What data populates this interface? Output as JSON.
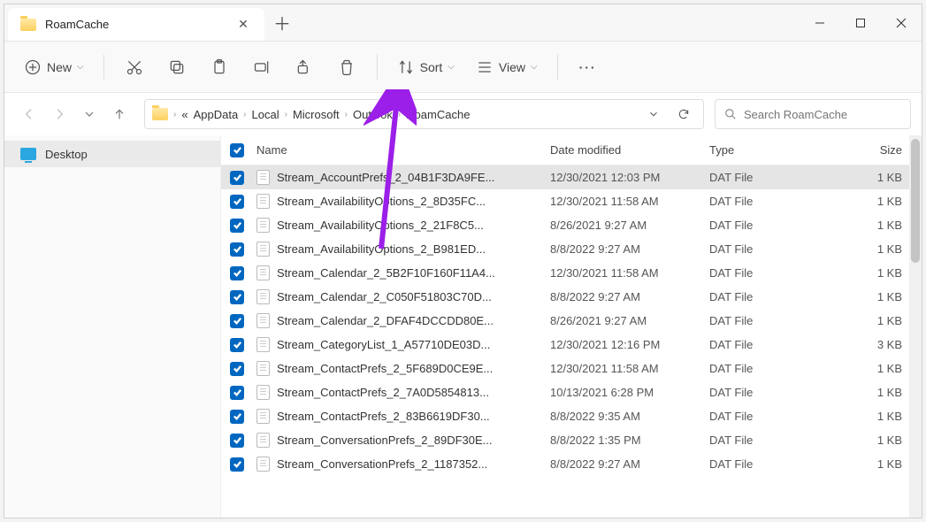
{
  "window": {
    "title": "RoamCache"
  },
  "toolbar": {
    "new_label": "New",
    "sort_label": "Sort",
    "view_label": "View"
  },
  "breadcrumbs": [
    "AppData",
    "Local",
    "Microsoft",
    "Outlook",
    "RoamCache"
  ],
  "search": {
    "placeholder": "Search RoamCache"
  },
  "sidebar": {
    "items": [
      {
        "label": "Desktop"
      }
    ]
  },
  "columns": {
    "name": "Name",
    "date": "Date modified",
    "type": "Type",
    "size": "Size"
  },
  "files": [
    {
      "name": "Stream_AccountPrefs_2_04B1F3DA9FE...",
      "date": "12/30/2021 12:03 PM",
      "type": "DAT File",
      "size": "1 KB",
      "selected": true
    },
    {
      "name": "Stream_AvailabilityOptions_2_8D35FC...",
      "date": "12/30/2021 11:58 AM",
      "type": "DAT File",
      "size": "1 KB",
      "selected": false
    },
    {
      "name": "Stream_AvailabilityOptions_2_21F8C5...",
      "date": "8/26/2021 9:27 AM",
      "type": "DAT File",
      "size": "1 KB",
      "selected": false
    },
    {
      "name": "Stream_AvailabilityOptions_2_B981ED...",
      "date": "8/8/2022 9:27 AM",
      "type": "DAT File",
      "size": "1 KB",
      "selected": false
    },
    {
      "name": "Stream_Calendar_2_5B2F10F160F11A4...",
      "date": "12/30/2021 11:58 AM",
      "type": "DAT File",
      "size": "1 KB",
      "selected": false
    },
    {
      "name": "Stream_Calendar_2_C050F51803C70D...",
      "date": "8/8/2022 9:27 AM",
      "type": "DAT File",
      "size": "1 KB",
      "selected": false
    },
    {
      "name": "Stream_Calendar_2_DFAF4DCCDD80E...",
      "date": "8/26/2021 9:27 AM",
      "type": "DAT File",
      "size": "1 KB",
      "selected": false
    },
    {
      "name": "Stream_CategoryList_1_A57710DE03D...",
      "date": "12/30/2021 12:16 PM",
      "type": "DAT File",
      "size": "3 KB",
      "selected": false
    },
    {
      "name": "Stream_ContactPrefs_2_5F689D0CE9E...",
      "date": "12/30/2021 11:58 AM",
      "type": "DAT File",
      "size": "1 KB",
      "selected": false
    },
    {
      "name": "Stream_ContactPrefs_2_7A0D5854813...",
      "date": "10/13/2021 6:28 PM",
      "type": "DAT File",
      "size": "1 KB",
      "selected": false
    },
    {
      "name": "Stream_ContactPrefs_2_83B6619DF30...",
      "date": "8/8/2022 9:35 AM",
      "type": "DAT File",
      "size": "1 KB",
      "selected": false
    },
    {
      "name": "Stream_ConversationPrefs_2_89DF30E...",
      "date": "8/8/2022 1:35 PM",
      "type": "DAT File",
      "size": "1 KB",
      "selected": false
    },
    {
      "name": "Stream_ConversationPrefs_2_1187352...",
      "date": "8/8/2022 9:27 AM",
      "type": "DAT File",
      "size": "1 KB",
      "selected": false
    }
  ]
}
